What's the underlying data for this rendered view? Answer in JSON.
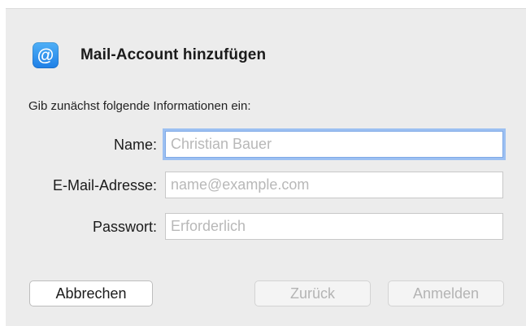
{
  "dialog": {
    "title": "Mail-Account hinzufügen",
    "icon": {
      "name": "at-sign-icon",
      "glyph": "@",
      "color": "#2b8cf0"
    },
    "intro": "Gib zunächst folgende Informationen ein:"
  },
  "form": {
    "name": {
      "label": "Name:",
      "value": "",
      "placeholder": "Christian Bauer"
    },
    "email": {
      "label": "E-Mail-Adresse:",
      "value": "",
      "placeholder": "name@example.com"
    },
    "password": {
      "label": "Passwort:",
      "value": "",
      "placeholder": "Erforderlich"
    }
  },
  "buttons": {
    "cancel": "Abbrechen",
    "back": "Zurück",
    "sign_in": "Anmelden"
  },
  "colors": {
    "dialog_background": "#ececec",
    "focus_ring": "#9cc0f2",
    "disabled_text": "#b4b4b4"
  }
}
